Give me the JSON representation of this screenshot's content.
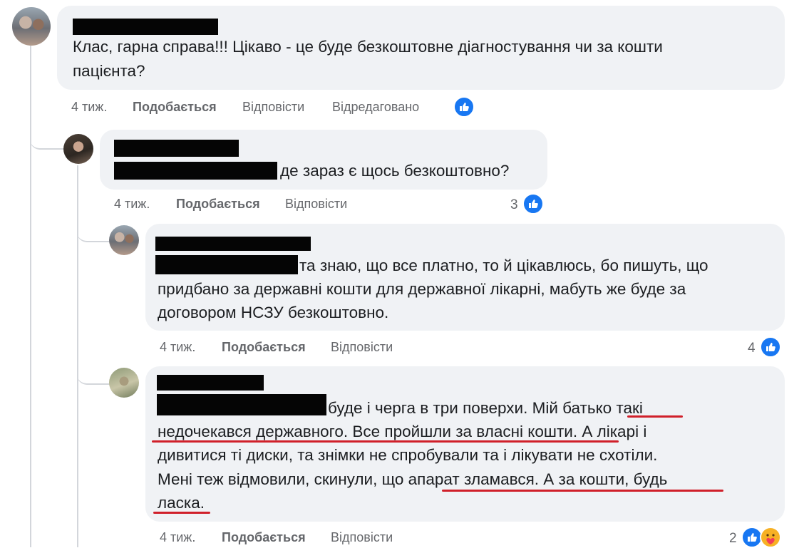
{
  "comments": [
    {
      "lines": [
        "Клас, гарна справа!!! Цікаво - це буде безкоштовне діагностування чи за кошти",
        "пацієнта?"
      ],
      "time": "4 тиж.",
      "like_label": "Подобається",
      "reply_label": "Відповісти",
      "edited_label": "Відредаговано",
      "reactions": {
        "icons": [
          "like-icon"
        ]
      }
    },
    {
      "lines": [
        "де зараз є щось безкоштовно?"
      ],
      "time": "4 тиж.",
      "like_label": "Подобається",
      "reply_label": "Відповісти",
      "reactions": {
        "count": "3",
        "icons": [
          "like-icon"
        ]
      }
    },
    {
      "lines": [
        "та знаю, що все платно, то й цікавлюсь, бо пишуть, що",
        "придбано за державні кошти для державної лікарні, мабуть же буде за",
        "договором НСЗУ безкоштовно."
      ],
      "time": "4 тиж.",
      "like_label": "Подобається",
      "reply_label": "Відповісти",
      "reactions": {
        "count": "4",
        "icons": [
          "like-icon"
        ]
      }
    },
    {
      "lines": [
        "буде і черга в три поверхи. Мій батько такі",
        "недочекався державного. Все пройшли за власні кошти. А лікарі і",
        "дивитися ті диски, та знімки не спробували та і лікувати не схотіли.",
        "Мені теж відмовили, скинули, що апарат зламався. А за кошти, будь",
        "ласка."
      ],
      "time": "4 тиж.",
      "like_label": "Подобається",
      "reply_label": "Відповісти",
      "reactions": {
        "count": "2",
        "icons": [
          "like-icon",
          "care-icon"
        ]
      }
    }
  ],
  "colors": {
    "accent": "#1877f2",
    "bubble": "#f0f2f5",
    "meta": "#65676b",
    "underline": "#d0202a"
  }
}
